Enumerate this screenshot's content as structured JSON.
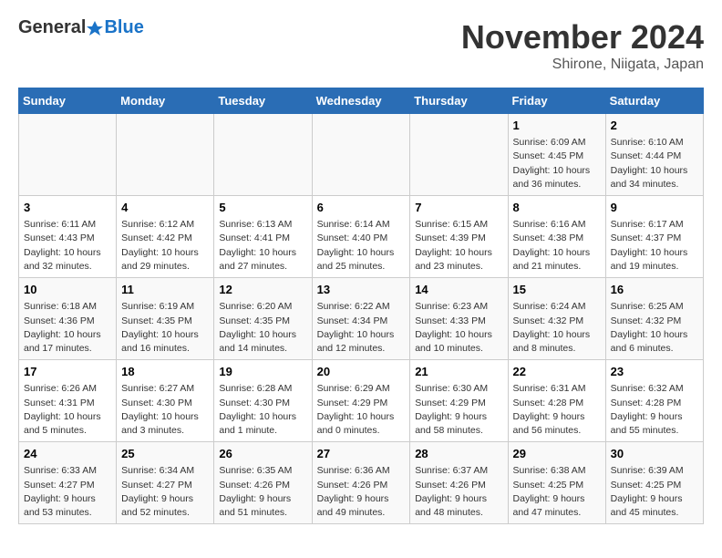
{
  "header": {
    "logo_general": "General",
    "logo_blue": "Blue",
    "title": "November 2024",
    "subtitle": "Shirone, Niigata, Japan"
  },
  "days_of_week": [
    "Sunday",
    "Monday",
    "Tuesday",
    "Wednesday",
    "Thursday",
    "Friday",
    "Saturday"
  ],
  "weeks": [
    {
      "days": [
        {
          "number": "",
          "info": ""
        },
        {
          "number": "",
          "info": ""
        },
        {
          "number": "",
          "info": ""
        },
        {
          "number": "",
          "info": ""
        },
        {
          "number": "",
          "info": ""
        },
        {
          "number": "1",
          "info": "Sunrise: 6:09 AM\nSunset: 4:45 PM\nDaylight: 10 hours\nand 36 minutes."
        },
        {
          "number": "2",
          "info": "Sunrise: 6:10 AM\nSunset: 4:44 PM\nDaylight: 10 hours\nand 34 minutes."
        }
      ]
    },
    {
      "days": [
        {
          "number": "3",
          "info": "Sunrise: 6:11 AM\nSunset: 4:43 PM\nDaylight: 10 hours\nand 32 minutes."
        },
        {
          "number": "4",
          "info": "Sunrise: 6:12 AM\nSunset: 4:42 PM\nDaylight: 10 hours\nand 29 minutes."
        },
        {
          "number": "5",
          "info": "Sunrise: 6:13 AM\nSunset: 4:41 PM\nDaylight: 10 hours\nand 27 minutes."
        },
        {
          "number": "6",
          "info": "Sunrise: 6:14 AM\nSunset: 4:40 PM\nDaylight: 10 hours\nand 25 minutes."
        },
        {
          "number": "7",
          "info": "Sunrise: 6:15 AM\nSunset: 4:39 PM\nDaylight: 10 hours\nand 23 minutes."
        },
        {
          "number": "8",
          "info": "Sunrise: 6:16 AM\nSunset: 4:38 PM\nDaylight: 10 hours\nand 21 minutes."
        },
        {
          "number": "9",
          "info": "Sunrise: 6:17 AM\nSunset: 4:37 PM\nDaylight: 10 hours\nand 19 minutes."
        }
      ]
    },
    {
      "days": [
        {
          "number": "10",
          "info": "Sunrise: 6:18 AM\nSunset: 4:36 PM\nDaylight: 10 hours\nand 17 minutes."
        },
        {
          "number": "11",
          "info": "Sunrise: 6:19 AM\nSunset: 4:35 PM\nDaylight: 10 hours\nand 16 minutes."
        },
        {
          "number": "12",
          "info": "Sunrise: 6:20 AM\nSunset: 4:35 PM\nDaylight: 10 hours\nand 14 minutes."
        },
        {
          "number": "13",
          "info": "Sunrise: 6:22 AM\nSunset: 4:34 PM\nDaylight: 10 hours\nand 12 minutes."
        },
        {
          "number": "14",
          "info": "Sunrise: 6:23 AM\nSunset: 4:33 PM\nDaylight: 10 hours\nand 10 minutes."
        },
        {
          "number": "15",
          "info": "Sunrise: 6:24 AM\nSunset: 4:32 PM\nDaylight: 10 hours\nand 8 minutes."
        },
        {
          "number": "16",
          "info": "Sunrise: 6:25 AM\nSunset: 4:32 PM\nDaylight: 10 hours\nand 6 minutes."
        }
      ]
    },
    {
      "days": [
        {
          "number": "17",
          "info": "Sunrise: 6:26 AM\nSunset: 4:31 PM\nDaylight: 10 hours\nand 5 minutes."
        },
        {
          "number": "18",
          "info": "Sunrise: 6:27 AM\nSunset: 4:30 PM\nDaylight: 10 hours\nand 3 minutes."
        },
        {
          "number": "19",
          "info": "Sunrise: 6:28 AM\nSunset: 4:30 PM\nDaylight: 10 hours\nand 1 minute."
        },
        {
          "number": "20",
          "info": "Sunrise: 6:29 AM\nSunset: 4:29 PM\nDaylight: 10 hours\nand 0 minutes."
        },
        {
          "number": "21",
          "info": "Sunrise: 6:30 AM\nSunset: 4:29 PM\nDaylight: 9 hours\nand 58 minutes."
        },
        {
          "number": "22",
          "info": "Sunrise: 6:31 AM\nSunset: 4:28 PM\nDaylight: 9 hours\nand 56 minutes."
        },
        {
          "number": "23",
          "info": "Sunrise: 6:32 AM\nSunset: 4:28 PM\nDaylight: 9 hours\nand 55 minutes."
        }
      ]
    },
    {
      "days": [
        {
          "number": "24",
          "info": "Sunrise: 6:33 AM\nSunset: 4:27 PM\nDaylight: 9 hours\nand 53 minutes."
        },
        {
          "number": "25",
          "info": "Sunrise: 6:34 AM\nSunset: 4:27 PM\nDaylight: 9 hours\nand 52 minutes."
        },
        {
          "number": "26",
          "info": "Sunrise: 6:35 AM\nSunset: 4:26 PM\nDaylight: 9 hours\nand 51 minutes."
        },
        {
          "number": "27",
          "info": "Sunrise: 6:36 AM\nSunset: 4:26 PM\nDaylight: 9 hours\nand 49 minutes."
        },
        {
          "number": "28",
          "info": "Sunrise: 6:37 AM\nSunset: 4:26 PM\nDaylight: 9 hours\nand 48 minutes."
        },
        {
          "number": "29",
          "info": "Sunrise: 6:38 AM\nSunset: 4:25 PM\nDaylight: 9 hours\nand 47 minutes."
        },
        {
          "number": "30",
          "info": "Sunrise: 6:39 AM\nSunset: 4:25 PM\nDaylight: 9 hours\nand 45 minutes."
        }
      ]
    }
  ]
}
